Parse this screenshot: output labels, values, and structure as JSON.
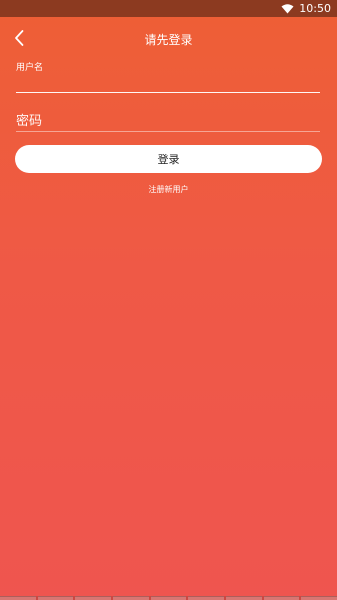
{
  "status_bar": {
    "time": "10:50",
    "wifi_icon": "wifi-icon"
  },
  "app_bar": {
    "title": "请先登录",
    "back_icon": "chevron-left-icon"
  },
  "form": {
    "username_label": "用户名",
    "username_value": "",
    "password_placeholder": "密码",
    "password_value": ""
  },
  "actions": {
    "login_label": "登录",
    "register_label": "注册新用户"
  },
  "colors": {
    "status_bar": "#8c3a20",
    "gradient_top": "#ee5f35",
    "gradient_bottom": "#ef554f",
    "button_bg": "#ffffff"
  }
}
